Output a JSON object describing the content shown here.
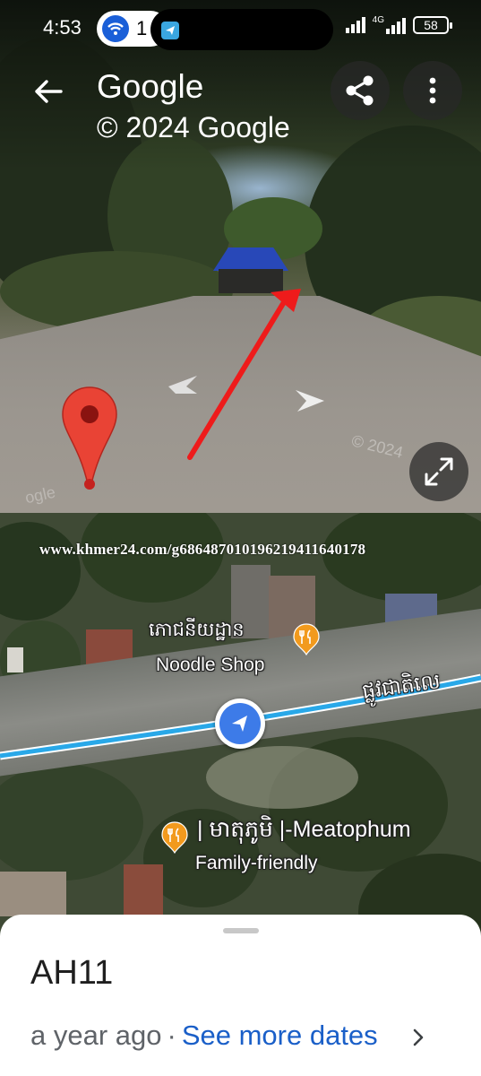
{
  "status_bar": {
    "time": "4:53",
    "hotspot_count": "1",
    "signal_tag": "4G",
    "battery": "58"
  },
  "street_view": {
    "title": "Google",
    "copyright": "© 2024 Google",
    "photo_watermark": "© 2024",
    "photo_watermark_2": "ogle",
    "buttons": {
      "back": "arrow-back-icon",
      "share": "share-icon",
      "more": "more-vert-icon",
      "expand": "expand-icon"
    }
  },
  "map": {
    "watermark": "www.khmer24.com/g686487010196219411640178",
    "places": [
      {
        "name": "ភោជនីយដ្ឋាន",
        "subtitle": "Noodle Shop",
        "icon": "restaurant-icon"
      },
      {
        "name": "| មាតុភូមិ |-Meatophum",
        "subtitle": "Family-friendly",
        "icon": "restaurant-icon"
      }
    ],
    "road_label": "ផ្លូវជាតិលេ",
    "colors": {
      "route": "#29a8e8",
      "poi": "#f29a1d",
      "marker": "#3d7be8"
    }
  },
  "sheet": {
    "title": "AH11",
    "date": "a year ago",
    "separator": "·",
    "see_more": "See more dates"
  }
}
